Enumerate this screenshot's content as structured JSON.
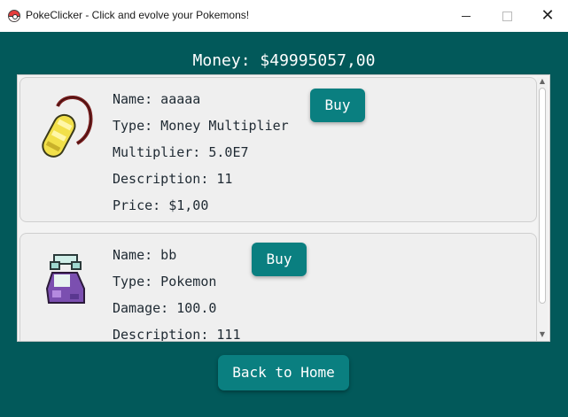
{
  "window": {
    "title": "PokeClicker - Click and evolve your Pokemons!",
    "icon": "pokeball-icon"
  },
  "money_label": "Money: $49995057,00",
  "items": [
    {
      "icon": "amulet-coin-icon",
      "name": "Name: aaaaa",
      "type": "Type: Money Multiplier",
      "stat": "Multiplier: 5.0E7",
      "description": "Description: 11",
      "price": "Price: $1,00",
      "buy_label": "Buy"
    },
    {
      "icon": "potion-bottle-icon",
      "name": "Name: bb",
      "type": "Type: Pokemon",
      "stat": "Damage: 100.0",
      "description": "Description: 111",
      "buy_label": "Buy"
    }
  ],
  "back_label": "Back to Home",
  "colors": {
    "background": "#02595a",
    "button": "#0a7f80",
    "card": "#efefef"
  }
}
